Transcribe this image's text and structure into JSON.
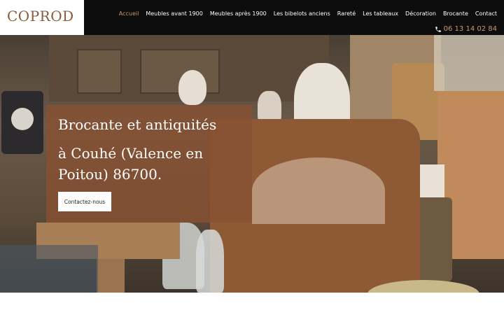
{
  "brand": {
    "logo": "COPROD"
  },
  "nav": {
    "items": [
      {
        "label": "Accueil",
        "active": true
      },
      {
        "label": "Meubles avant 1900"
      },
      {
        "label": "Meubles après 1900"
      },
      {
        "label": "Les bibelots anciens"
      },
      {
        "label": "Rareté"
      },
      {
        "label": "Les tableaux"
      },
      {
        "label": "Décoration"
      },
      {
        "label": "Brocante"
      },
      {
        "label": "Contact"
      }
    ]
  },
  "contact": {
    "phone": "06 13 14 02 84",
    "icon": "phone-icon"
  },
  "hero": {
    "title": "Brocante et antiquités",
    "subtitle": "à Couhé (Valence en Poitou) 86700.",
    "cta_label": "Contactez-nous"
  },
  "colors": {
    "header_bg": "#0d0d0d",
    "accent": "#c49a6c",
    "logo": "#8a5a3c",
    "overlay": "#875032"
  }
}
